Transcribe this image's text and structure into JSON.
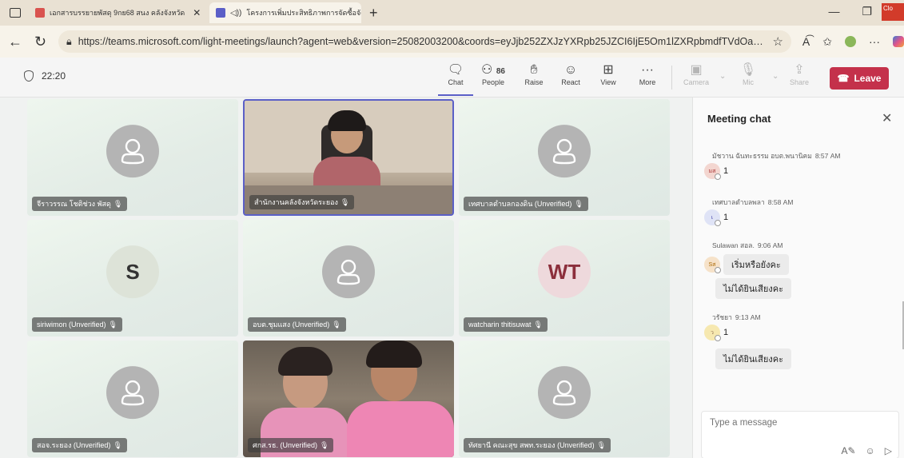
{
  "browser": {
    "tabs": [
      {
        "title": "เอกสารบรรยายพัสดุ 9กย68 สนง คลังจังหวัด",
        "favicon_color": "#d9534f",
        "active": false
      },
      {
        "title": "โครงการเพิ่มประสิทธิภาพการจัดซื้อจัดจ้าง",
        "favicon_color": "#5b5fc7",
        "active": true
      }
    ],
    "close_overlay_label": "Clo",
    "url": "https://teams.microsoft.com/light-meetings/launch?agent=web&version=25082003200&coords=eyJjb252ZXJzYXRpb25JZCI6IjE5Om1lZXRpbmdfTVdOa09XUT..."
  },
  "meeting": {
    "elapsed": "22:20",
    "controls": [
      {
        "id": "chat",
        "label": "Chat",
        "icon": "chat-icon",
        "active": true
      },
      {
        "id": "people",
        "label": "People",
        "icon": "people-icon",
        "count": "86"
      },
      {
        "id": "raise",
        "label": "Raise",
        "icon": "hand-icon"
      },
      {
        "id": "react",
        "label": "React",
        "icon": "smile-icon"
      },
      {
        "id": "view",
        "label": "View",
        "icon": "grid-icon"
      },
      {
        "id": "more",
        "label": "More",
        "icon": "more-icon"
      },
      {
        "id": "camera",
        "label": "Camera",
        "icon": "camera-off-icon",
        "disabled": true
      },
      {
        "id": "mic",
        "label": "Mic",
        "icon": "mic-off-icon",
        "disabled": true
      },
      {
        "id": "share",
        "label": "Share",
        "icon": "share-icon",
        "disabled": true
      }
    ],
    "leave_label": "Leave",
    "accent": "#5b5fc7",
    "leave_color": "#c4314b"
  },
  "participants": [
    {
      "name": "จีราวรรณ โชติช่วง พัสดุ",
      "type": "avatar"
    },
    {
      "name": "สำนักงานคลังจังหวัดระยอง",
      "type": "video",
      "speaking": true
    },
    {
      "name": "เทศบาลตำบลกองดิน (Unverified)",
      "type": "avatar"
    },
    {
      "name": "siriwimon (Unverified)",
      "type": "letter",
      "initials": "S"
    },
    {
      "name": "อบต.ชุมแสง (Unverified)",
      "type": "avatar"
    },
    {
      "name": "watcharin thitisuwat",
      "type": "letter",
      "initials": "WT"
    },
    {
      "name": "สอจ.ระยอง (Unverified)",
      "type": "avatar"
    },
    {
      "name": "ศกส.รธ. (Unverified)",
      "type": "video2"
    },
    {
      "name": "ทัศยานี คณะสุข สพท.ระยอง (Unverified)",
      "type": "avatar"
    }
  ],
  "chat": {
    "title": "Meeting chat",
    "messages": [
      {
        "author": "มัชวาน ฉันทะธรรม อบต.พนานิคม",
        "time": "8:57 AM",
        "initials": "มส",
        "reaction_count": "1"
      },
      {
        "author": "เทศบาลตำบลพลา",
        "time": "8:58 AM",
        "initials": "เ",
        "reaction_count": "1"
      },
      {
        "author": "Sulawan สอล.",
        "time": "9:06 AM",
        "initials": "Sส",
        "text": "เริ่มหรือยังคะ",
        "followup": "ไม่ได้ยินเสียงคะ"
      },
      {
        "author": "วรัชยา",
        "time": "9:13 AM",
        "initials": "ว",
        "reaction_count": "1",
        "followup": "ไม่ได้ยินเสียงคะ"
      }
    ],
    "compose_placeholder": "Type a message"
  }
}
